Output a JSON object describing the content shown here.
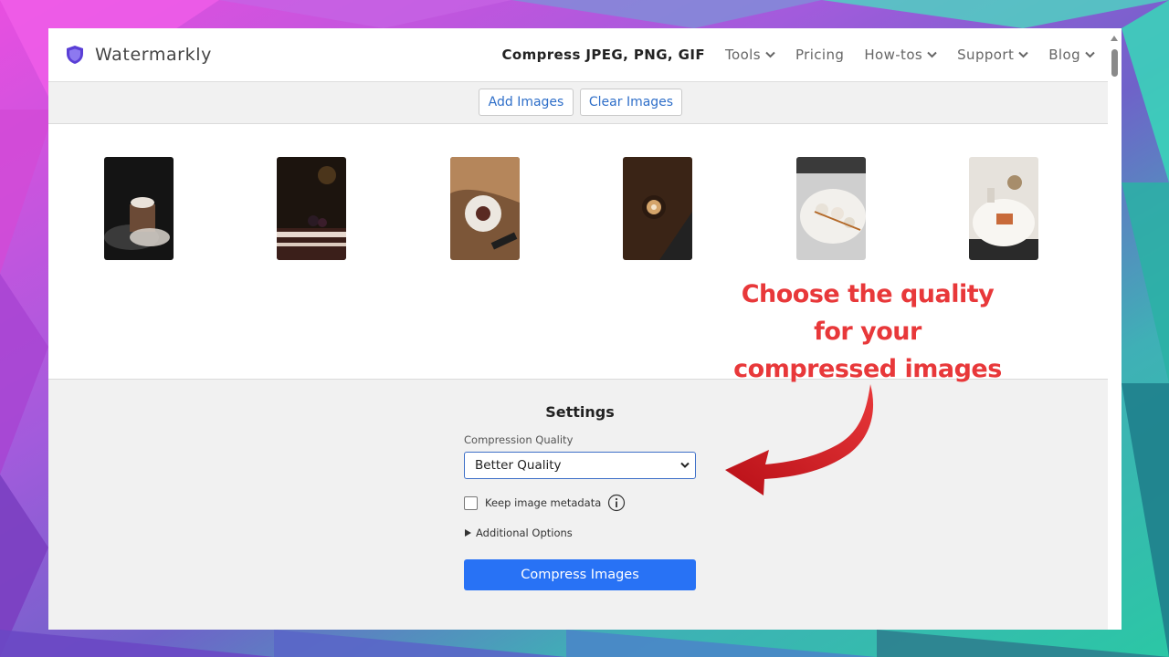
{
  "colors": {
    "accent": "#2872f5",
    "link": "#2f6fc9",
    "callout": "#e8383a",
    "brand_icon": "#5a3fd6"
  },
  "header": {
    "brand": "Watermarkly",
    "brand_icon": "shield-icon",
    "nav": [
      {
        "label": "Compress JPEG, PNG, GIF",
        "active": true
      },
      {
        "label": "Tools",
        "dropdown": true
      },
      {
        "label": "Pricing"
      },
      {
        "label": "How-tos",
        "dropdown": true
      },
      {
        "label": "Support",
        "dropdown": true
      },
      {
        "label": "Blog",
        "dropdown": true
      }
    ]
  },
  "toolbar": {
    "add_label": "Add Images",
    "clear_label": "Clear Images"
  },
  "gallery": {
    "count": 6
  },
  "settings": {
    "title": "Settings",
    "quality_label": "Compression Quality",
    "quality_value": "Better Quality",
    "metadata_label": "Keep image metadata",
    "metadata_checked": false,
    "additional_label": "Additional Options",
    "compress_label": "Compress Images"
  },
  "annotation": {
    "lines": [
      "Choose the quality",
      "for your",
      "compressed images"
    ]
  }
}
